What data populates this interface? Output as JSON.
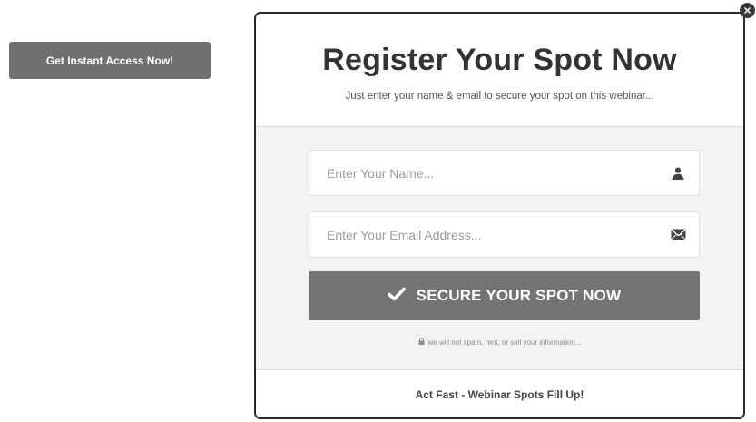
{
  "page": {
    "cta_label": "Get Instant Access Now!"
  },
  "modal": {
    "title": "Register Your Spot Now",
    "subtitle": "Just enter your name & email to secure your spot on this webinar...",
    "name_field": {
      "placeholder": "Enter Your Name...",
      "icon": "user-icon"
    },
    "email_field": {
      "placeholder": "Enter Your Email Address...",
      "icon": "envelope-icon"
    },
    "submit_label": "SECURE YOUR SPOT NOW",
    "submit_icon": "checkmark-icon",
    "privacy_note": "we will not spam, rent, or sell your information...",
    "privacy_icon": "lock-icon",
    "footer_text": "Act Fast - Webinar Spots Fill Up!",
    "close_icon": "close-icon"
  },
  "colors": {
    "button_gray": "#707070",
    "modal_border": "#2b2b2b",
    "modal_body_bg": "#f3f3f3"
  }
}
